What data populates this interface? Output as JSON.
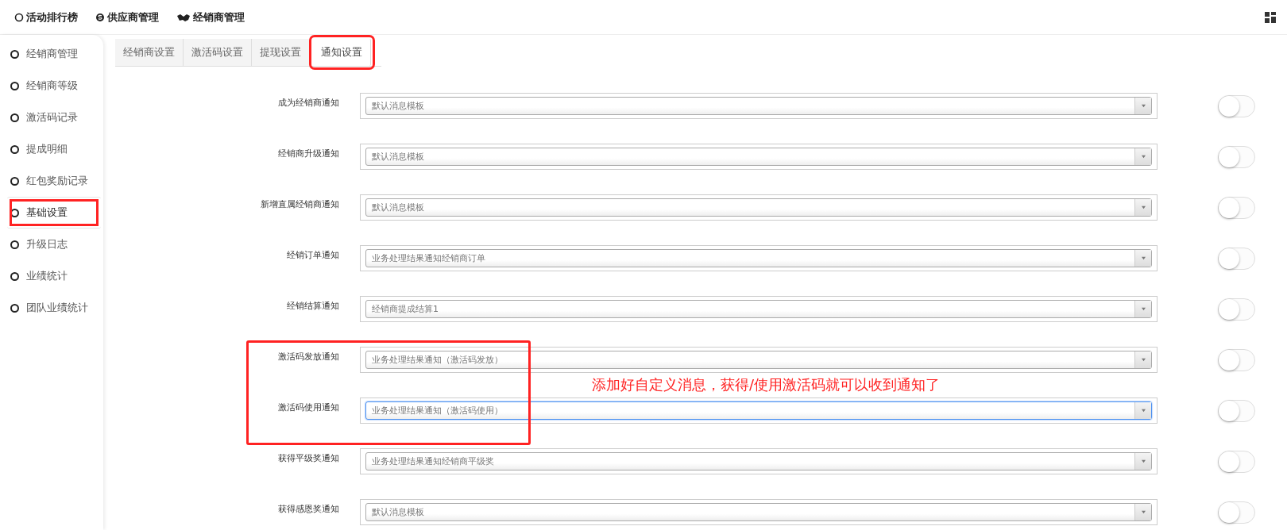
{
  "top_nav": [
    {
      "label": "活动排行榜"
    },
    {
      "label": "供应商管理"
    },
    {
      "label": "经销商管理"
    }
  ],
  "sidebar": {
    "items": [
      {
        "label": "经销商管理",
        "selected": false,
        "highlighted": false
      },
      {
        "label": "经销商等级",
        "selected": false,
        "highlighted": false
      },
      {
        "label": "激活码记录",
        "selected": false,
        "highlighted": false
      },
      {
        "label": "提成明细",
        "selected": false,
        "highlighted": false
      },
      {
        "label": "红包奖励记录",
        "selected": false,
        "highlighted": false
      },
      {
        "label": "基础设置",
        "selected": true,
        "highlighted": true
      },
      {
        "label": "升级日志",
        "selected": false,
        "highlighted": false
      },
      {
        "label": "业绩统计",
        "selected": false,
        "highlighted": false
      },
      {
        "label": "团队业绩统计",
        "selected": false,
        "highlighted": false
      }
    ]
  },
  "tabs": [
    {
      "label": "经销商设置",
      "selected": false,
      "highlighted": false
    },
    {
      "label": "激活码设置",
      "selected": false,
      "highlighted": false
    },
    {
      "label": "提现设置",
      "selected": false,
      "highlighted": false
    },
    {
      "label": "通知设置",
      "selected": true,
      "highlighted": true
    }
  ],
  "sections": [
    {
      "highlighted": false,
      "rows": [
        {
          "label": "成为经销商通知",
          "value": "默认消息模板",
          "focused": false,
          "on": false
        },
        {
          "label": "经销商升级通知",
          "value": "默认消息模板",
          "focused": false,
          "on": false
        },
        {
          "label": "新增直属经销商通知",
          "value": "默认消息模板",
          "focused": false,
          "on": false
        },
        {
          "label": "经销订单通知",
          "value": "业务处理结果通知经销商订单",
          "focused": false,
          "on": false
        },
        {
          "label": "经销结算通知",
          "value": "经销商提成结算1",
          "focused": false,
          "on": false
        }
      ]
    },
    {
      "highlighted": true,
      "rows": [
        {
          "label": "激活码发放通知",
          "value": "业务处理结果通知（激活码发放）",
          "focused": false,
          "on": false
        },
        {
          "label": "激活码使用通知",
          "value": "业务处理结果通知（激活码使用）",
          "focused": true,
          "on": false
        }
      ]
    },
    {
      "highlighted": false,
      "rows": [
        {
          "label": "获得平级奖通知",
          "value": "业务处理结果通知经销商平级奖",
          "focused": false,
          "on": false
        },
        {
          "label": "获得感恩奖通知",
          "value": "默认消息模板",
          "focused": false,
          "on": false
        }
      ]
    }
  ],
  "annotation": {
    "text": "添加好自定义消息，获得/使用激活码就可以收到通知了"
  }
}
